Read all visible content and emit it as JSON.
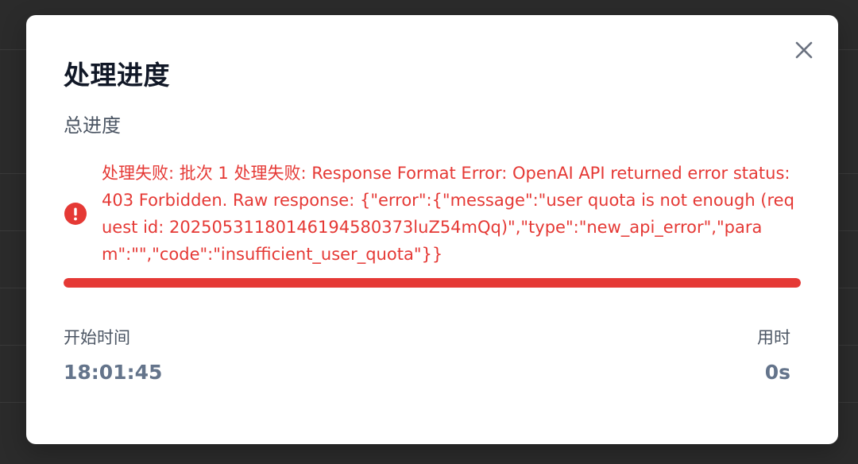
{
  "dialog": {
    "title": "处理进度",
    "close_icon": "close-icon"
  },
  "progress": {
    "section_label": "总进度",
    "status": "error",
    "error_icon": "exclamation-circle-icon",
    "error_message": "处理失败: 批次 1 处理失败: Response Format Error: OpenAI API returned error status: 403 Forbidden. Raw response: {\"error\":{\"message\":\"user quota is not enough (request id: 20250531180146194580373luZ54mQq)\",\"type\":\"new_api_error\",\"param\":\"\",\"code\":\"insufficient_user_quota\"}}",
    "fill_fraction": 1.0
  },
  "start_time": {
    "label": "开始时间",
    "value": "18:01:45"
  },
  "elapsed": {
    "label": "用时",
    "value": "0s"
  },
  "colors": {
    "error": "#e53935",
    "overlay": "#2b2b2b",
    "panel": "#ffffff"
  }
}
